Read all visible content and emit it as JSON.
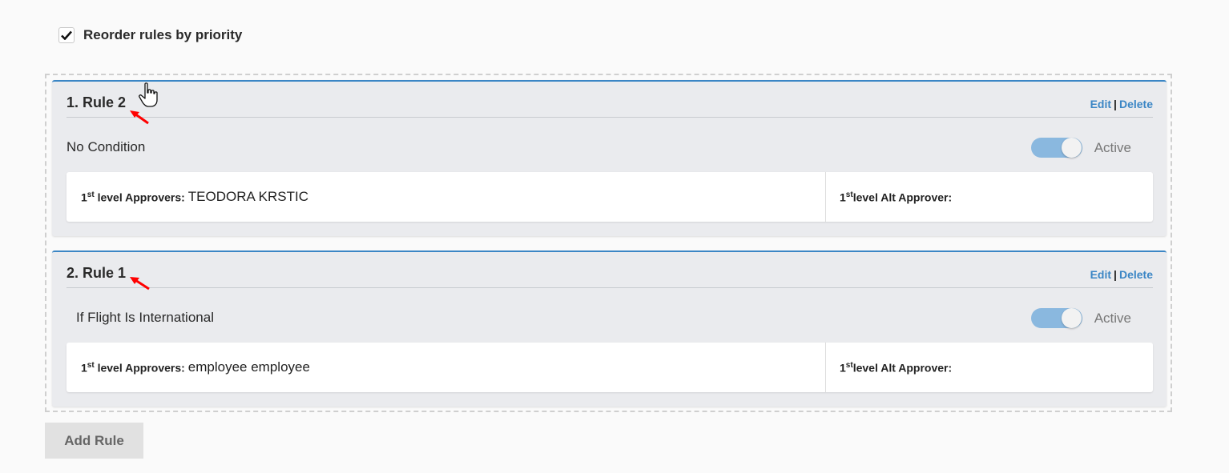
{
  "reorder": {
    "label": "Reorder rules by priority",
    "checked": true
  },
  "rules": [
    {
      "title": "1. Rule 2",
      "edit": "Edit",
      "sep": "|",
      "delete": "Delete",
      "condition": "No Condition",
      "status": "Active",
      "active": true,
      "approver_ord": "1",
      "approver_sup": "st",
      "approver_label": " level Approvers:",
      "approver_value": "TEODORA KRSTIC",
      "alt_ord": "1",
      "alt_sup": "st",
      "alt_label": "level Alt Approver:",
      "alt_value": ""
    },
    {
      "title": "2. Rule 1",
      "edit": "Edit",
      "sep": "|",
      "delete": "Delete",
      "condition": "If Flight Is International",
      "status": "Active",
      "active": true,
      "approver_ord": "1",
      "approver_sup": "st",
      "approver_label": " level Approvers:",
      "approver_value": "employee employee",
      "alt_ord": "1",
      "alt_sup": "st",
      "alt_label": "level Alt Approver:",
      "alt_value": ""
    }
  ],
  "add_rule_label": "Add Rule",
  "colors": {
    "accent": "#3b86c5",
    "toggle_on": "#8ab8df",
    "annotation": "#ff0000"
  }
}
